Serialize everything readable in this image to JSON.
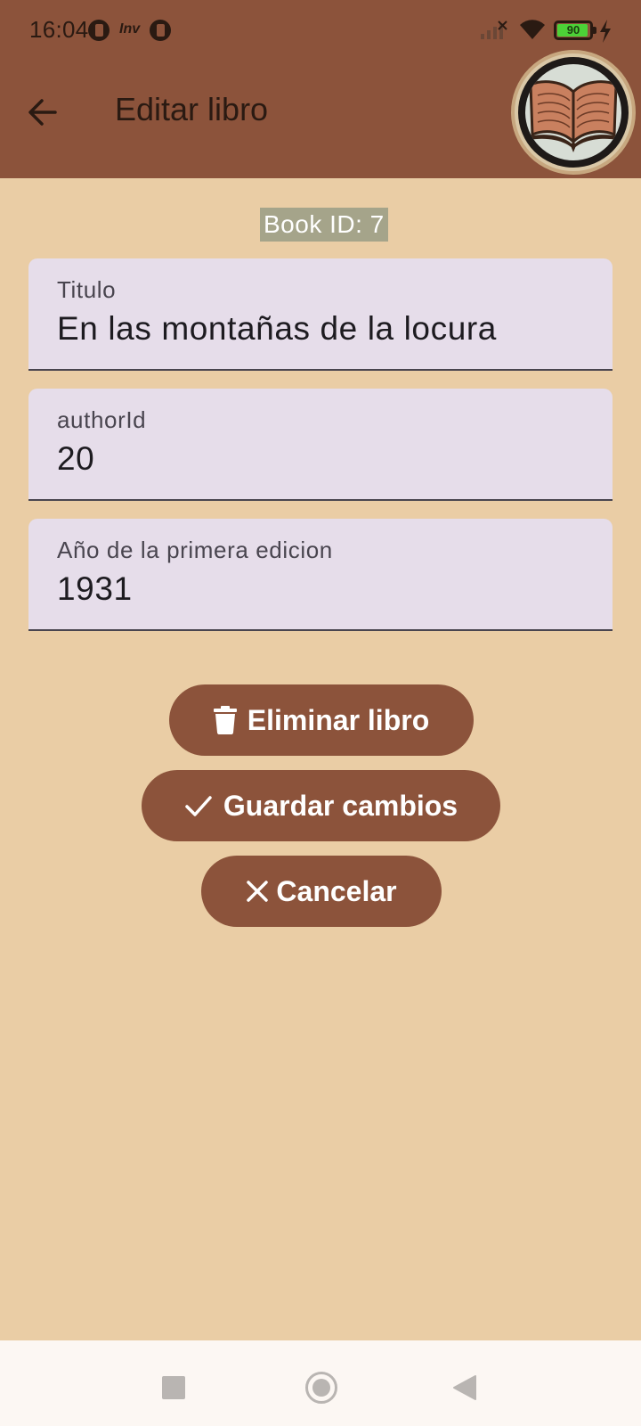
{
  "status_bar": {
    "time": "16:04",
    "notification_text": "Inv",
    "battery_level": "90",
    "icons": [
      "notification-icon",
      "signal-icon",
      "wifi-icon",
      "battery-icon",
      "charging-icon"
    ]
  },
  "app_bar": {
    "title": "Editar libro",
    "back_icon": "arrow-back-icon",
    "logo_icon": "open-book-logo"
  },
  "book_id_label": "Book ID: 7",
  "fields": [
    {
      "label": "Titulo",
      "value": "En las montañas de la locura"
    },
    {
      "label": "authorId",
      "value": "20"
    },
    {
      "label": "Año de la primera edicion",
      "value": "1931"
    }
  ],
  "buttons": {
    "delete": {
      "label": "Eliminar libro",
      "icon": "trash-icon"
    },
    "save": {
      "label": "Guardar cambios",
      "icon": "check-icon"
    },
    "cancel": {
      "label": "Cancelar",
      "icon": "close-icon"
    }
  },
  "navigation_bar": {
    "icons": [
      "recents-icon",
      "home-icon",
      "back-nav-icon"
    ]
  },
  "colors": {
    "primary": "#8C533B",
    "background": "#EACDA5",
    "field_background": "#E6DDEA",
    "book_id_background": "#A5A48A",
    "nav_background": "#FCF7F3"
  }
}
